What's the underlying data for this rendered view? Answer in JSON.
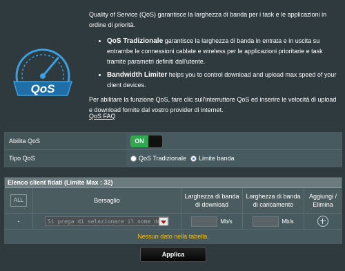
{
  "intro": {
    "paragraph1": "Quality of Service (QoS) garantisce la larghezza di banda per i task e le applicazioni in ordine di priorità.",
    "bullet1_title": "QoS Tradizionale",
    "bullet1_text": " garantisce la larghezza di banda in entrata e in uscita su entrambe le connessioni cablate e wireless per le applicazioni prioritarie e task tramite parametri definiti dall'utente.",
    "bullet2_title": "Bandwidth Limiter",
    "bullet2_text": " helps you to control download and upload max speed of your client devices.",
    "paragraph2": "Per abilitare la funzione QoS, fare clic sull'interruttore QoS ed inserire le velocità di upload e download fornite dal vostro provider di internet.",
    "faq_link": "QoS FAQ",
    "logo_text": "QoS"
  },
  "settings": {
    "enable_label": "Abilita QoS",
    "toggle_on": "ON",
    "type_label": "Tipo QoS",
    "options": [
      "QoS Tradizionale",
      "Limite banda"
    ],
    "selected_option": "Limite banda"
  },
  "clients": {
    "title": "Elenco client fidati (Limite Max : 32)",
    "all_button": "ALL",
    "col_target": "Bersaglio",
    "col_download": "Larghezza di banda di download",
    "col_upload": "Larghezza di banda di caricamento",
    "col_add": "Aggiungi / Elimina",
    "row_dash": "-",
    "select_placeholder": "Si prega di selezionare il nome del",
    "unit": "Mb/s",
    "no_data": "Nessun dato nella tabella."
  },
  "apply_label": "Applica",
  "colors": {
    "background": "#2f3a3e",
    "toggle_on": "#2fa84f",
    "no_data_text": "#f0c020",
    "logo_blue": "#3aa0e0"
  }
}
